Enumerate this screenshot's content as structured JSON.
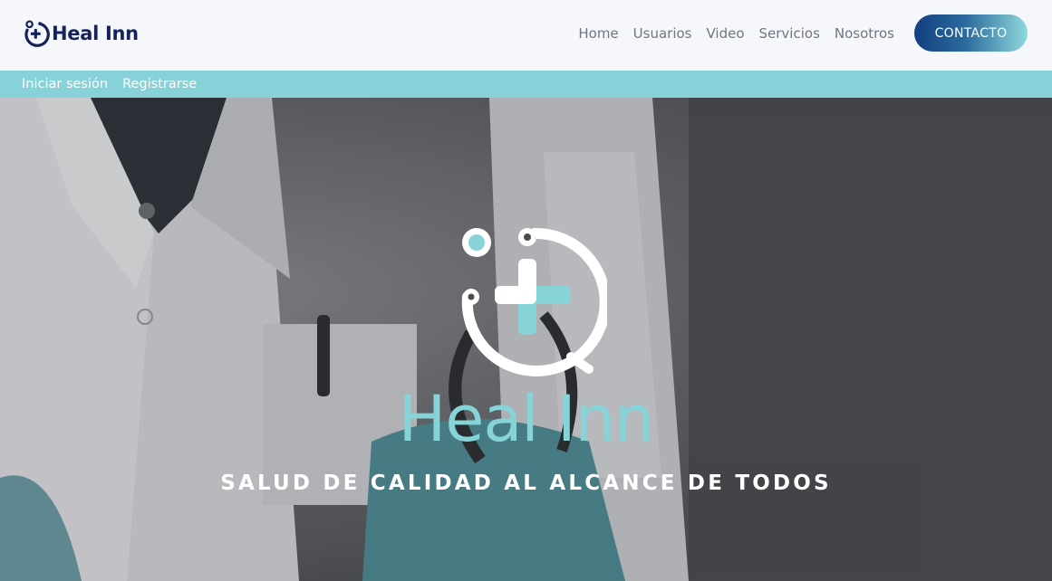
{
  "brand": {
    "name": "Heal Inn",
    "icon": "stethoscope-plus-icon"
  },
  "nav": {
    "links": [
      "Home",
      "Usuarios",
      "Video",
      "Servicios",
      "Nosotros"
    ],
    "contact_label": "CONTACTO"
  },
  "auth": {
    "login": "Iniciar sesión",
    "register": "Registrarse"
  },
  "hero": {
    "title": "Heal Inn",
    "subtitle": "SALUD DE CALIDAD AL ALCANCE DE TODOS",
    "logo_icon": "stethoscope-plus-icon",
    "background": "doctor-photo"
  },
  "colors": {
    "navy": "#16235a",
    "teal": "#87d2d8",
    "nav_text": "#6f7680",
    "button_gradient_start": "#123f80",
    "button_gradient_end": "#8fd9dc"
  }
}
